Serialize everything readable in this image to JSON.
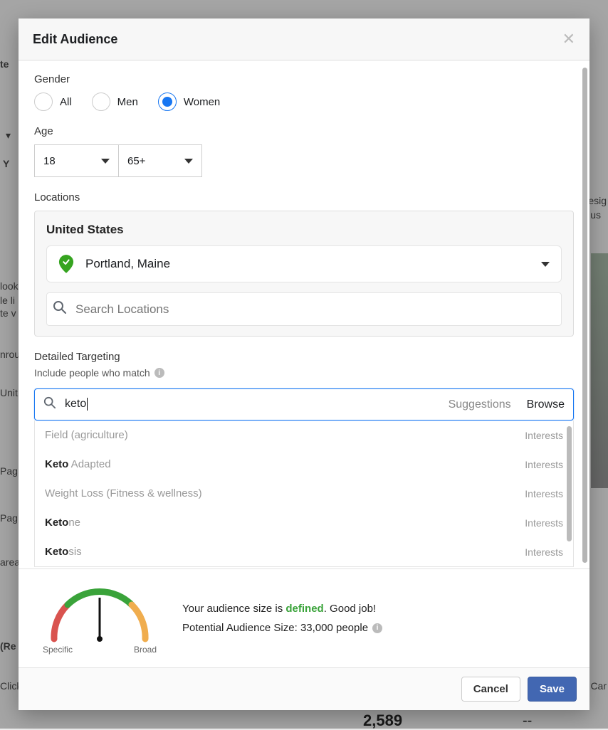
{
  "modal": {
    "title": "Edit Audience",
    "gender": {
      "label": "Gender",
      "options": [
        "All",
        "Men",
        "Women"
      ],
      "selected": "Women"
    },
    "age": {
      "label": "Age",
      "min": "18",
      "max": "65+"
    },
    "locations": {
      "label": "Locations",
      "country": "United States",
      "selected": "Portland, Maine",
      "search_placeholder": "Search Locations"
    },
    "detailed": {
      "label": "Detailed Targeting",
      "sub": "Include people who match",
      "query": "keto",
      "suggestions_label": "Suggestions",
      "browse_label": "Browse",
      "results": [
        {
          "label_html": "Field (agriculture)",
          "bold": "",
          "category": "Interests"
        },
        {
          "label_html": "Keto Adapted",
          "bold": "Keto",
          "rest": " Adapted",
          "category": "Interests"
        },
        {
          "label_html": "Weight Loss (Fitness & wellness)",
          "bold": "",
          "category": "Interests"
        },
        {
          "label_html": "Ketone",
          "bold": "Keto",
          "rest": "ne",
          "category": "Interests"
        },
        {
          "label_html": "Ketosis",
          "bold": "Keto",
          "rest": "sis",
          "category": "Interests"
        }
      ]
    },
    "footer": {
      "gauge_specific": "Specific",
      "gauge_broad": "Broad",
      "line1_prefix": "Your audience size is ",
      "line1_defined": "defined",
      "line1_suffix": ". Good job!",
      "line2": "Potential Audience Size: 33,000 people"
    },
    "actions": {
      "cancel": "Cancel",
      "save": "Save"
    }
  },
  "background": {
    "frag1": "te",
    "frag2": "Y",
    "frag3": "look",
    "frag4": "le li",
    "frag5": "te v",
    "frag6": "nrou",
    "frag7": "Unit",
    "frag8": "Pag",
    "frag9": "Pag",
    "frag10": "area",
    "frag11": "(Re",
    "frag12": "Click",
    "frag13": "2,589",
    "frag14": "--",
    "frag15": "esig",
    "frag16": "us",
    "frag17": "Car"
  }
}
